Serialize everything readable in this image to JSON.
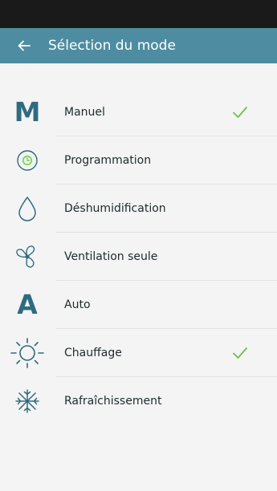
{
  "header": {
    "title": "Sélection du mode",
    "back_icon": "arrow-left-icon"
  },
  "colors": {
    "app_bar": "#4e8da1",
    "icon": "#2f6b80",
    "check": "#6cc04a",
    "clock_ring": "#6cc04a"
  },
  "modes": [
    {
      "label": "Manuel",
      "icon": "letter-m-icon",
      "icon_text": "M",
      "selected": true
    },
    {
      "label": "Programmation",
      "icon": "clock-icon",
      "selected": false
    },
    {
      "label": "Déshumidification",
      "icon": "water-drop-icon",
      "selected": false
    },
    {
      "label": "Ventilation seule",
      "icon": "fan-icon",
      "selected": false
    },
    {
      "label": "Auto",
      "icon": "letter-a-icon",
      "icon_text": "A",
      "selected": false
    },
    {
      "label": "Chauffage",
      "icon": "sun-icon",
      "selected": true
    },
    {
      "label": "Rafraîchissement",
      "icon": "snowflake-icon",
      "selected": false
    }
  ]
}
